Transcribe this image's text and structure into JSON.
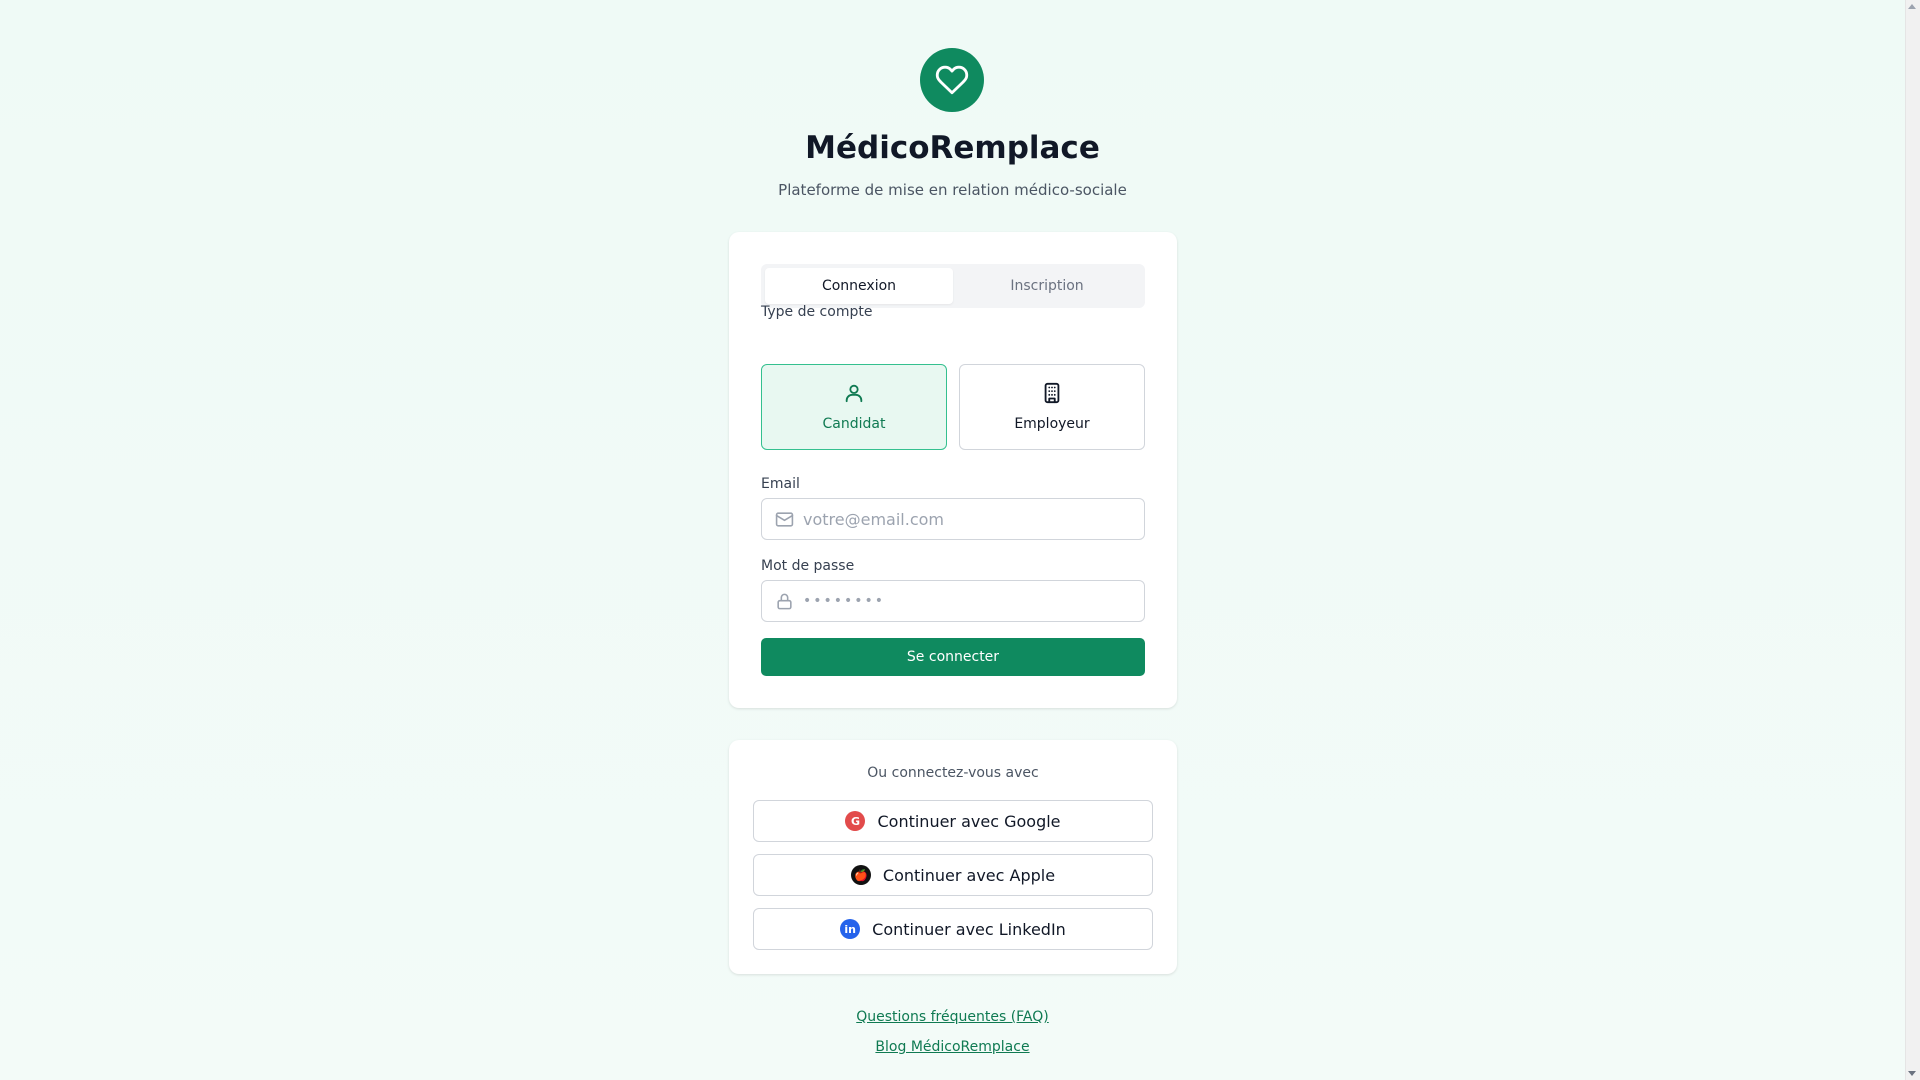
{
  "brand": {
    "title": "MédicoRemplace",
    "subtitle": "Plateforme de mise en relation médico-sociale",
    "logo_icon": "heart-icon",
    "accent_color": "#0f8a5f"
  },
  "auth_tabs": {
    "login": "Connexion",
    "signup": "Inscription",
    "active": "Connexion"
  },
  "account_type": {
    "label": "Type de compte",
    "options": [
      {
        "label": "Candidat",
        "icon": "user-icon",
        "selected": true
      },
      {
        "label": "Employeur",
        "icon": "building-icon",
        "selected": false
      }
    ]
  },
  "form": {
    "email_label": "Email",
    "email_placeholder": "votre@email.com",
    "email_icon": "mail-icon",
    "password_label": "Mot de passe",
    "password_placeholder": "••••••••",
    "password_icon": "lock-icon",
    "submit_label": "Se connecter"
  },
  "social": {
    "heading": "Ou connectez-vous avec",
    "google_label": "Continuer avec Google",
    "google_glyph": "G",
    "apple_label": "Continuer avec Apple",
    "apple_glyph": "🍎",
    "linkedin_label": "Continuer avec LinkedIn",
    "linkedin_glyph": "in"
  },
  "footer": {
    "faq": "Questions fréquentes (FAQ)",
    "blog": "Blog MédicoRemplace"
  }
}
